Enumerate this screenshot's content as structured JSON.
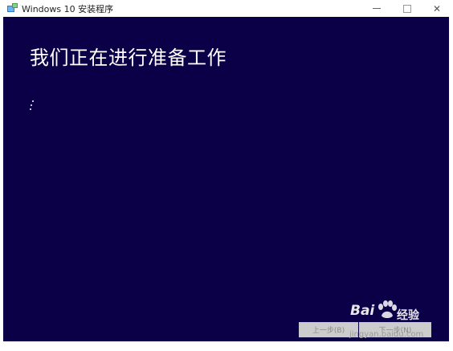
{
  "window": {
    "title": "Windows 10 安装程序",
    "controls": {
      "minimize": "minimize",
      "maximize": "maximize",
      "close": "✕"
    }
  },
  "main": {
    "heading": "我们正在进行准备工作",
    "background_color": "#0b0047"
  },
  "footer": {
    "back_label": "上一步(B)",
    "next_label": "下一步(N)"
  },
  "watermark": {
    "brand_latin": "Bai",
    "brand_cn": "经验",
    "domain": "jingyan.baidu.com"
  },
  "icons": {
    "app": "windows-setup-icon",
    "spinner": "loading-spinner-icon",
    "watermark": "baidu-paw-icon"
  }
}
